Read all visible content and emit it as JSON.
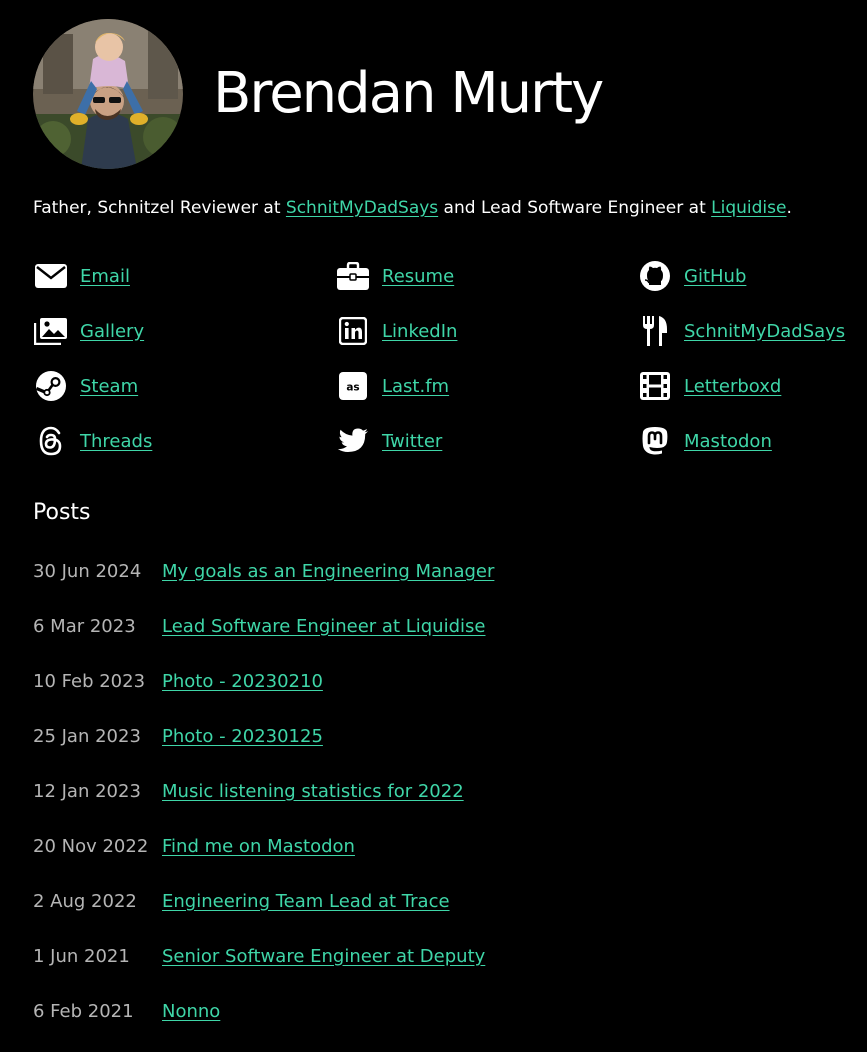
{
  "profile": {
    "name": "Brendan Murty",
    "avatar_alt": "avatar photo"
  },
  "bio": {
    "prefix": "Father, Schnitzel Reviewer at ",
    "link1": "SchnitMyDadSays",
    "middle": " and Lead Software Engineer at ",
    "link2": "Liquidise",
    "suffix": "."
  },
  "colors": {
    "background": "#000000",
    "text": "#ffffff",
    "link": "#3fd6a8",
    "muted": "#b5b5b5"
  },
  "links": [
    {
      "label": "Email",
      "icon": "envelope-icon"
    },
    {
      "label": "Resume",
      "icon": "briefcase-icon"
    },
    {
      "label": "GitHub",
      "icon": "github-icon"
    },
    {
      "label": "Gallery",
      "icon": "photo-gallery-icon"
    },
    {
      "label": "LinkedIn",
      "icon": "linkedin-icon"
    },
    {
      "label": "SchnitMyDadSays",
      "icon": "utensils-icon"
    },
    {
      "label": "Steam",
      "icon": "steam-icon"
    },
    {
      "label": "Last.fm",
      "icon": "lastfm-icon"
    },
    {
      "label": "Letterboxd",
      "icon": "film-icon"
    },
    {
      "label": "Threads",
      "icon": "threads-icon"
    },
    {
      "label": "Twitter",
      "icon": "twitter-icon"
    },
    {
      "label": "Mastodon",
      "icon": "mastodon-icon"
    }
  ],
  "posts": {
    "title": "Posts",
    "items": [
      {
        "date": "30 Jun 2024",
        "title": "My goals as an Engineering Manager"
      },
      {
        "date": "6 Mar 2023",
        "title": "Lead Software Engineer at Liquidise"
      },
      {
        "date": "10 Feb 2023",
        "title": "Photo - 20230210"
      },
      {
        "date": "25 Jan 2023",
        "title": "Photo - 20230125"
      },
      {
        "date": "12 Jan 2023",
        "title": "Music listening statistics for 2022"
      },
      {
        "date": "20 Nov 2022",
        "title": "Find me on Mastodon"
      },
      {
        "date": "2 Aug 2022",
        "title": "Engineering Team Lead at Trace"
      },
      {
        "date": "1 Jun 2021",
        "title": "Senior Software Engineer at Deputy"
      },
      {
        "date": "6 Feb 2021",
        "title": "Nonno"
      }
    ]
  }
}
